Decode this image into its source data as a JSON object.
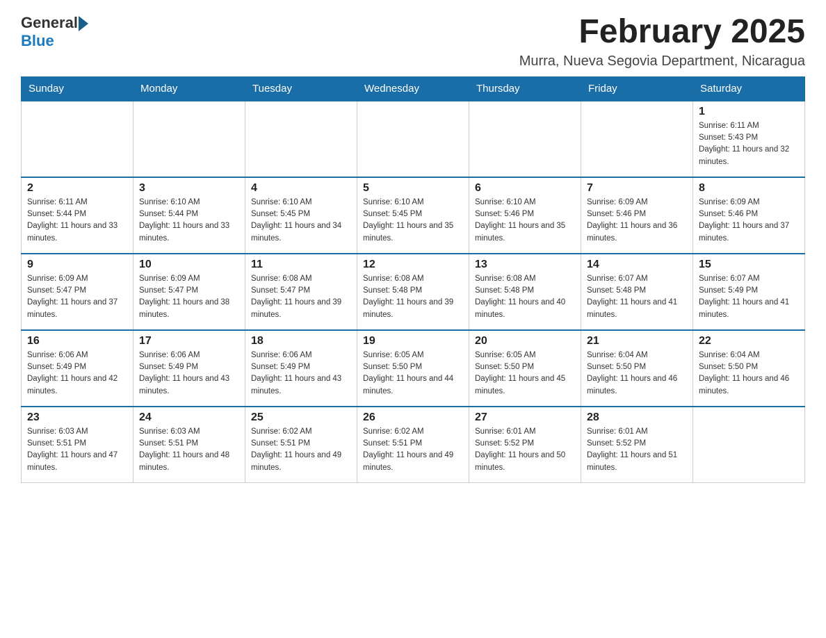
{
  "header": {
    "logo_general": "General",
    "logo_blue": "Blue",
    "month_title": "February 2025",
    "location": "Murra, Nueva Segovia Department, Nicaragua"
  },
  "calendar": {
    "days_of_week": [
      "Sunday",
      "Monday",
      "Tuesday",
      "Wednesday",
      "Thursday",
      "Friday",
      "Saturday"
    ],
    "weeks": [
      {
        "days": [
          {
            "num": "",
            "sunrise": "",
            "sunset": "",
            "daylight": ""
          },
          {
            "num": "",
            "sunrise": "",
            "sunset": "",
            "daylight": ""
          },
          {
            "num": "",
            "sunrise": "",
            "sunset": "",
            "daylight": ""
          },
          {
            "num": "",
            "sunrise": "",
            "sunset": "",
            "daylight": ""
          },
          {
            "num": "",
            "sunrise": "",
            "sunset": "",
            "daylight": ""
          },
          {
            "num": "",
            "sunrise": "",
            "sunset": "",
            "daylight": ""
          },
          {
            "num": "1",
            "sunrise": "Sunrise: 6:11 AM",
            "sunset": "Sunset: 5:43 PM",
            "daylight": "Daylight: 11 hours and 32 minutes."
          }
        ]
      },
      {
        "days": [
          {
            "num": "2",
            "sunrise": "Sunrise: 6:11 AM",
            "sunset": "Sunset: 5:44 PM",
            "daylight": "Daylight: 11 hours and 33 minutes."
          },
          {
            "num": "3",
            "sunrise": "Sunrise: 6:10 AM",
            "sunset": "Sunset: 5:44 PM",
            "daylight": "Daylight: 11 hours and 33 minutes."
          },
          {
            "num": "4",
            "sunrise": "Sunrise: 6:10 AM",
            "sunset": "Sunset: 5:45 PM",
            "daylight": "Daylight: 11 hours and 34 minutes."
          },
          {
            "num": "5",
            "sunrise": "Sunrise: 6:10 AM",
            "sunset": "Sunset: 5:45 PM",
            "daylight": "Daylight: 11 hours and 35 minutes."
          },
          {
            "num": "6",
            "sunrise": "Sunrise: 6:10 AM",
            "sunset": "Sunset: 5:46 PM",
            "daylight": "Daylight: 11 hours and 35 minutes."
          },
          {
            "num": "7",
            "sunrise": "Sunrise: 6:09 AM",
            "sunset": "Sunset: 5:46 PM",
            "daylight": "Daylight: 11 hours and 36 minutes."
          },
          {
            "num": "8",
            "sunrise": "Sunrise: 6:09 AM",
            "sunset": "Sunset: 5:46 PM",
            "daylight": "Daylight: 11 hours and 37 minutes."
          }
        ]
      },
      {
        "days": [
          {
            "num": "9",
            "sunrise": "Sunrise: 6:09 AM",
            "sunset": "Sunset: 5:47 PM",
            "daylight": "Daylight: 11 hours and 37 minutes."
          },
          {
            "num": "10",
            "sunrise": "Sunrise: 6:09 AM",
            "sunset": "Sunset: 5:47 PM",
            "daylight": "Daylight: 11 hours and 38 minutes."
          },
          {
            "num": "11",
            "sunrise": "Sunrise: 6:08 AM",
            "sunset": "Sunset: 5:47 PM",
            "daylight": "Daylight: 11 hours and 39 minutes."
          },
          {
            "num": "12",
            "sunrise": "Sunrise: 6:08 AM",
            "sunset": "Sunset: 5:48 PM",
            "daylight": "Daylight: 11 hours and 39 minutes."
          },
          {
            "num": "13",
            "sunrise": "Sunrise: 6:08 AM",
            "sunset": "Sunset: 5:48 PM",
            "daylight": "Daylight: 11 hours and 40 minutes."
          },
          {
            "num": "14",
            "sunrise": "Sunrise: 6:07 AM",
            "sunset": "Sunset: 5:48 PM",
            "daylight": "Daylight: 11 hours and 41 minutes."
          },
          {
            "num": "15",
            "sunrise": "Sunrise: 6:07 AM",
            "sunset": "Sunset: 5:49 PM",
            "daylight": "Daylight: 11 hours and 41 minutes."
          }
        ]
      },
      {
        "days": [
          {
            "num": "16",
            "sunrise": "Sunrise: 6:06 AM",
            "sunset": "Sunset: 5:49 PM",
            "daylight": "Daylight: 11 hours and 42 minutes."
          },
          {
            "num": "17",
            "sunrise": "Sunrise: 6:06 AM",
            "sunset": "Sunset: 5:49 PM",
            "daylight": "Daylight: 11 hours and 43 minutes."
          },
          {
            "num": "18",
            "sunrise": "Sunrise: 6:06 AM",
            "sunset": "Sunset: 5:49 PM",
            "daylight": "Daylight: 11 hours and 43 minutes."
          },
          {
            "num": "19",
            "sunrise": "Sunrise: 6:05 AM",
            "sunset": "Sunset: 5:50 PM",
            "daylight": "Daylight: 11 hours and 44 minutes."
          },
          {
            "num": "20",
            "sunrise": "Sunrise: 6:05 AM",
            "sunset": "Sunset: 5:50 PM",
            "daylight": "Daylight: 11 hours and 45 minutes."
          },
          {
            "num": "21",
            "sunrise": "Sunrise: 6:04 AM",
            "sunset": "Sunset: 5:50 PM",
            "daylight": "Daylight: 11 hours and 46 minutes."
          },
          {
            "num": "22",
            "sunrise": "Sunrise: 6:04 AM",
            "sunset": "Sunset: 5:50 PM",
            "daylight": "Daylight: 11 hours and 46 minutes."
          }
        ]
      },
      {
        "days": [
          {
            "num": "23",
            "sunrise": "Sunrise: 6:03 AM",
            "sunset": "Sunset: 5:51 PM",
            "daylight": "Daylight: 11 hours and 47 minutes."
          },
          {
            "num": "24",
            "sunrise": "Sunrise: 6:03 AM",
            "sunset": "Sunset: 5:51 PM",
            "daylight": "Daylight: 11 hours and 48 minutes."
          },
          {
            "num": "25",
            "sunrise": "Sunrise: 6:02 AM",
            "sunset": "Sunset: 5:51 PM",
            "daylight": "Daylight: 11 hours and 49 minutes."
          },
          {
            "num": "26",
            "sunrise": "Sunrise: 6:02 AM",
            "sunset": "Sunset: 5:51 PM",
            "daylight": "Daylight: 11 hours and 49 minutes."
          },
          {
            "num": "27",
            "sunrise": "Sunrise: 6:01 AM",
            "sunset": "Sunset: 5:52 PM",
            "daylight": "Daylight: 11 hours and 50 minutes."
          },
          {
            "num": "28",
            "sunrise": "Sunrise: 6:01 AM",
            "sunset": "Sunset: 5:52 PM",
            "daylight": "Daylight: 11 hours and 51 minutes."
          },
          {
            "num": "",
            "sunrise": "",
            "sunset": "",
            "daylight": ""
          }
        ]
      }
    ]
  }
}
